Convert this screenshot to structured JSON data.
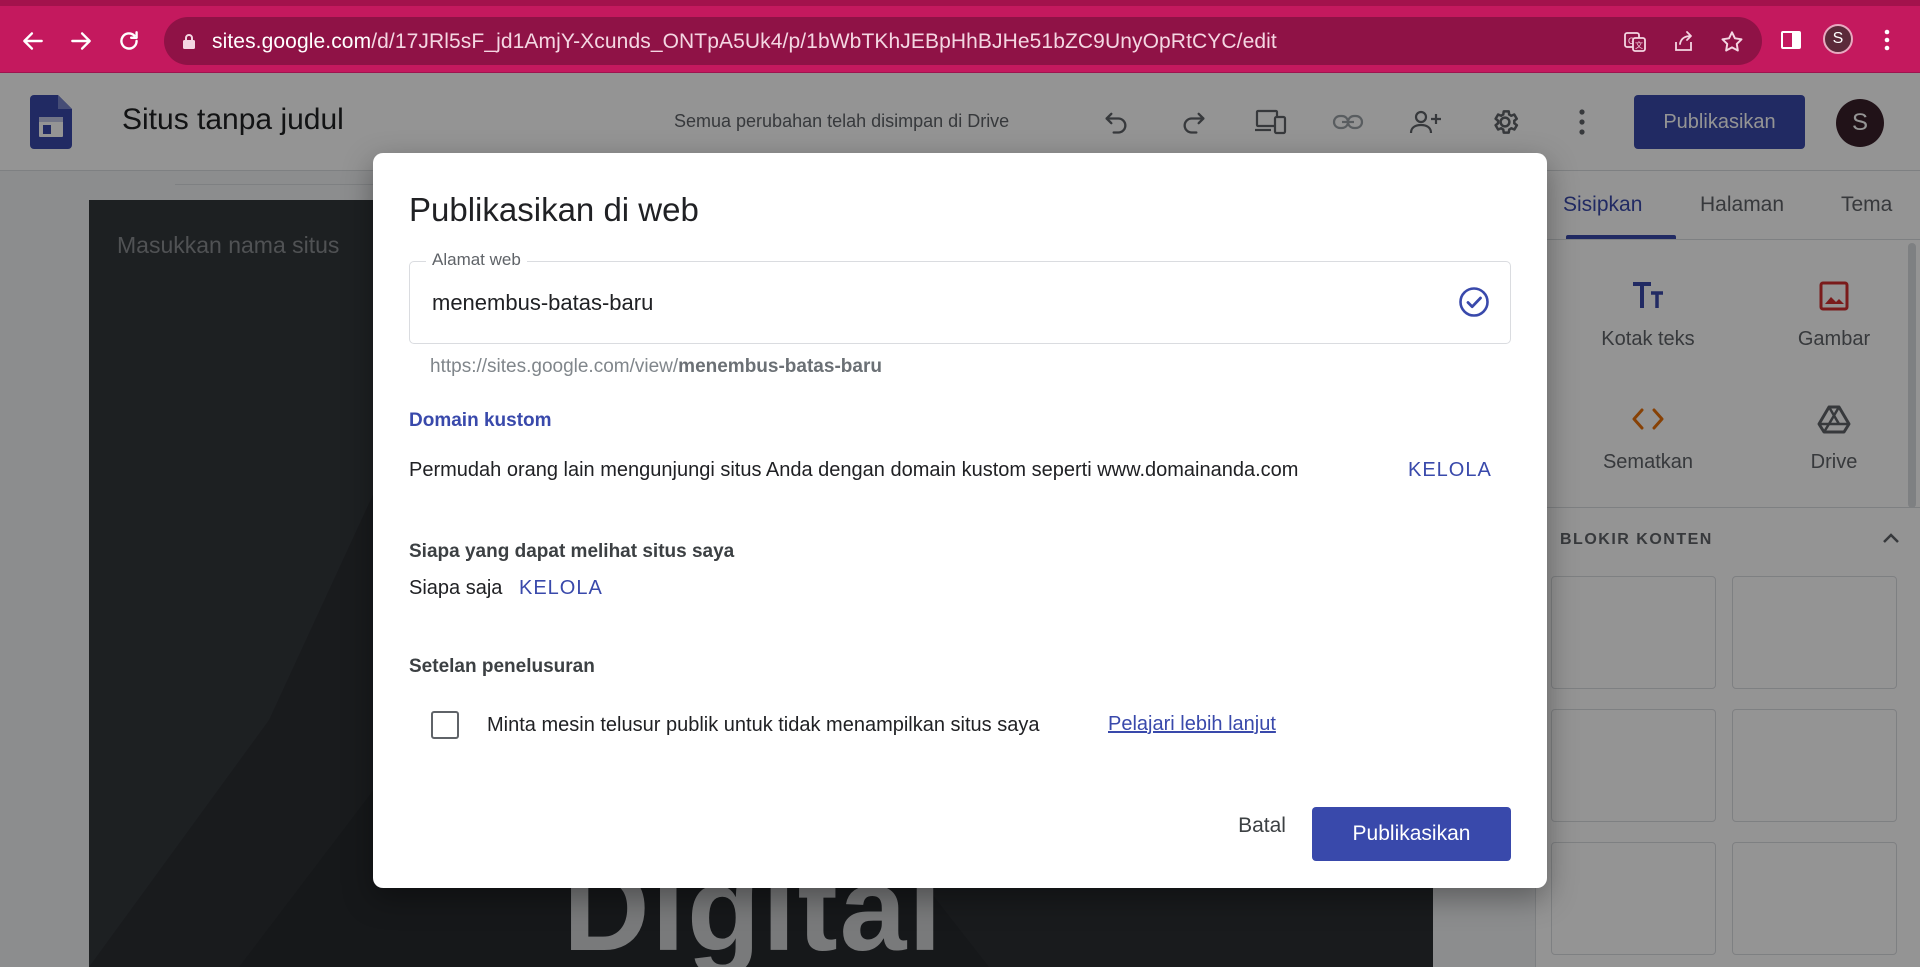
{
  "browser": {
    "url_host": "sites.google.com",
    "url_path": "/d/17JRl5sF_jd1AmjY-Xcunds_ONTpA5Uk4/p/1bWbTKhJEBpHhBJHe51bZC9UnyOpRtCYC/edit",
    "profile_initial": "S"
  },
  "toolbar": {
    "site_title": "Situs tanpa judul",
    "save_status": "Semua perubahan telah disimpan di Drive",
    "publish_label": "Publikasikan",
    "avatar_initial": "S"
  },
  "editor": {
    "site_name_placeholder": "Masukkan nama situs",
    "hero_text": "Digital"
  },
  "panel": {
    "tabs": [
      {
        "label": "Sisipkan",
        "active": true
      },
      {
        "label": "Halaman",
        "active": false
      },
      {
        "label": "Tema",
        "active": false
      }
    ],
    "insert_items": [
      {
        "label": "Kotak teks",
        "icon": "text-box-icon"
      },
      {
        "label": "Gambar",
        "icon": "image-icon"
      },
      {
        "label": "Sematkan",
        "icon": "embed-icon"
      },
      {
        "label": "Drive",
        "icon": "drive-icon"
      }
    ],
    "content_blocks_heading": "BLOKIR KONTEN"
  },
  "dialog": {
    "title": "Publikasikan di web",
    "web_address_label": "Alamat web",
    "web_address_value": "menembus-batas-baru",
    "url_prefix": "https://sites.google.com/view/",
    "url_slug": "menembus-batas-baru",
    "custom_domain_heading": "Domain kustom",
    "custom_domain_text": "Permudah orang lain mengunjungi situs Anda dengan domain kustom seperti www.domainanda.com",
    "custom_domain_manage": "KELOLA",
    "visibility_heading": "Siapa yang dapat melihat situs saya",
    "visibility_value": "Siapa saja",
    "visibility_manage": "KELOLA",
    "search_heading": "Setelan penelusuran",
    "search_checkbox_label": "Minta mesin telusur publik untuk tidak menampilkan situs saya",
    "search_checkbox_checked": false,
    "learn_more": "Pelajari lebih lanjut",
    "cancel_label": "Batal",
    "publish_label": "Publikasikan"
  },
  "colors": {
    "browser_accent": "#c4195e",
    "primary": "#3949ab"
  }
}
